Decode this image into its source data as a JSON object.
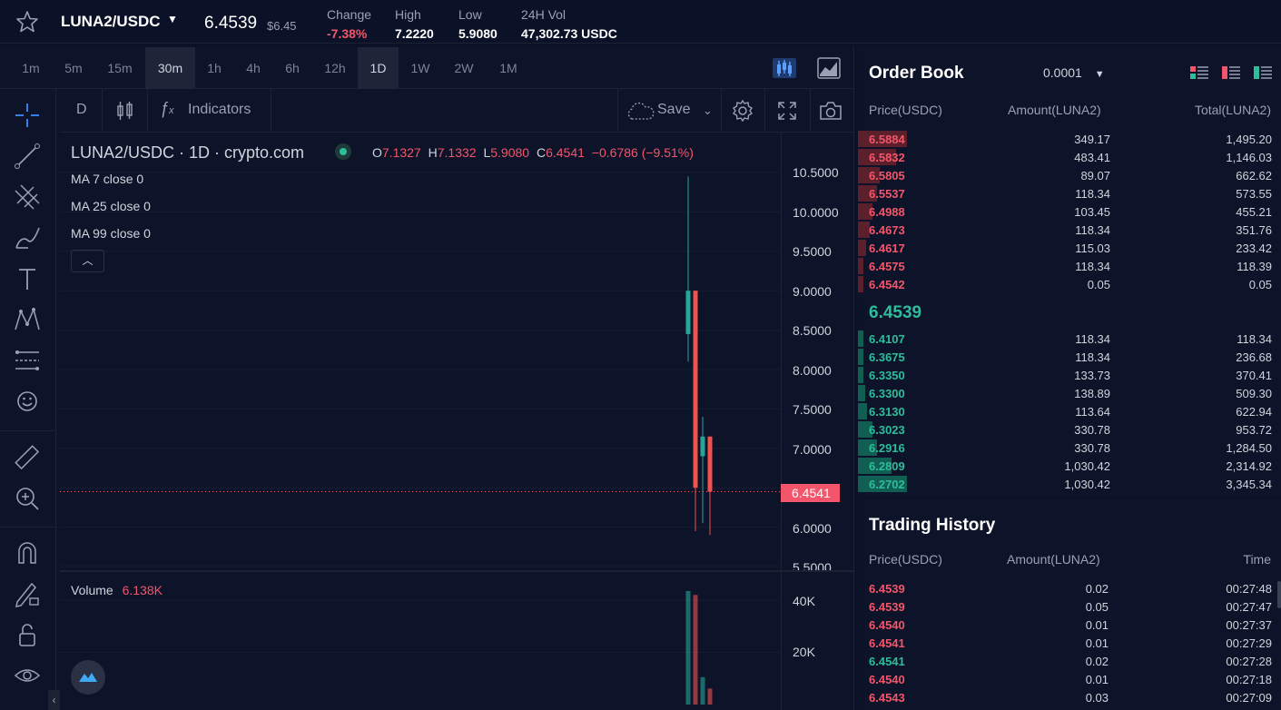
{
  "header": {
    "pair": "LUNA2/USDC",
    "last_price": "6.4539",
    "last_price_usd": "$6.45",
    "stats": [
      {
        "label": "Change",
        "value": "-7.38%",
        "negative": true
      },
      {
        "label": "High",
        "value": "7.2220",
        "negative": false
      },
      {
        "label": "Low",
        "value": "5.9080",
        "negative": false
      },
      {
        "label": "24H Vol",
        "value": "47,302.73 USDC",
        "negative": false
      }
    ]
  },
  "intervals": [
    "1m",
    "5m",
    "15m",
    "30m",
    "1h",
    "4h",
    "6h",
    "12h",
    "1D",
    "1W",
    "2W",
    "1M"
  ],
  "toolbar": {
    "resolution": "D",
    "indicators_label": "Indicators",
    "save_label": "Save"
  },
  "chart_legend": {
    "title": "LUNA2/USDC · 1D · crypto.com",
    "o_label": "O",
    "o_value": "7.1327",
    "h_label": "H",
    "h_value": "7.1332",
    "l_label": "L",
    "l_value": "5.9080",
    "c_label": "C",
    "c_value": "6.4541",
    "change": "−0.6786 (−9.51%)",
    "ma": [
      "MA 7 close 0",
      "MA 25 close 0",
      "MA 99 close 0"
    ],
    "volume_label": "Volume",
    "volume_value": "6.138K"
  },
  "chart_data": {
    "type": "candlestick",
    "price_axis_ticks": [
      "10.5000",
      "10.0000",
      "9.5000",
      "9.0000",
      "8.5000",
      "8.0000",
      "7.5000",
      "7.0000",
      "6.0000",
      "5.5000"
    ],
    "current_price_tag": "6.4541",
    "volume_axis_ticks": [
      "40K",
      "20K"
    ],
    "candles": [
      {
        "open": 8.45,
        "high": 10.45,
        "low": 8.1,
        "close": 9.0,
        "volume": 43500
      },
      {
        "open": 9.0,
        "high": 9.0,
        "low": 5.95,
        "close": 6.5,
        "volume": 42000
      },
      {
        "open": 6.9,
        "high": 7.4,
        "low": 6.05,
        "close": 7.15,
        "volume": 10500
      },
      {
        "open": 7.15,
        "high": 7.15,
        "low": 5.9,
        "close": 6.45,
        "volume": 6138
      }
    ],
    "candle_colors": [
      "up",
      "down",
      "up",
      "down"
    ],
    "colors": {
      "up": "#26a69a",
      "down": "#ef5350"
    }
  },
  "order_book": {
    "title": "Order Book",
    "precision": "0.0001",
    "headers": {
      "price": "Price(USDC)",
      "amount": "Amount(LUNA2)",
      "total": "Total(LUNA2)"
    },
    "asks": [
      {
        "price": "6.5884",
        "amount": "349.17",
        "total": "1,495.20",
        "depth": 1.0
      },
      {
        "price": "6.5832",
        "amount": "483.41",
        "total": "1,146.03",
        "depth": 0.77
      },
      {
        "price": "6.5805",
        "amount": "89.07",
        "total": "662.62",
        "depth": 0.44
      },
      {
        "price": "6.5537",
        "amount": "118.34",
        "total": "573.55",
        "depth": 0.38
      },
      {
        "price": "6.4988",
        "amount": "103.45",
        "total": "455.21",
        "depth": 0.3
      },
      {
        "price": "6.4673",
        "amount": "118.34",
        "total": "351.76",
        "depth": 0.24
      },
      {
        "price": "6.4617",
        "amount": "115.03",
        "total": "233.42",
        "depth": 0.16
      },
      {
        "price": "6.4575",
        "amount": "118.34",
        "total": "118.39",
        "depth": 0.08
      },
      {
        "price": "6.4542",
        "amount": "0.05",
        "total": "0.05",
        "depth": 0.01
      }
    ],
    "mid_price": "6.4539",
    "bids": [
      {
        "price": "6.4107",
        "amount": "118.34",
        "total": "118.34",
        "depth": 0.04
      },
      {
        "price": "6.3675",
        "amount": "118.34",
        "total": "236.68",
        "depth": 0.07
      },
      {
        "price": "6.3350",
        "amount": "133.73",
        "total": "370.41",
        "depth": 0.11
      },
      {
        "price": "6.3300",
        "amount": "138.89",
        "total": "509.30",
        "depth": 0.15
      },
      {
        "price": "6.3130",
        "amount": "113.64",
        "total": "622.94",
        "depth": 0.19
      },
      {
        "price": "6.3023",
        "amount": "330.78",
        "total": "953.72",
        "depth": 0.29
      },
      {
        "price": "6.2916",
        "amount": "330.78",
        "total": "1,284.50",
        "depth": 0.38
      },
      {
        "price": "6.2809",
        "amount": "1,030.42",
        "total": "2,314.92",
        "depth": 0.69
      },
      {
        "price": "6.2702",
        "amount": "1,030.42",
        "total": "3,345.34",
        "depth": 1.0
      }
    ]
  },
  "trading_history": {
    "title": "Trading History",
    "headers": {
      "price": "Price(USDC)",
      "amount": "Amount(LUNA2)",
      "time": "Time"
    },
    "rows": [
      {
        "price": "6.4539",
        "amount": "0.02",
        "time": "00:27:48",
        "side": "down"
      },
      {
        "price": "6.4539",
        "amount": "0.05",
        "time": "00:27:47",
        "side": "down"
      },
      {
        "price": "6.4540",
        "amount": "0.01",
        "time": "00:27:37",
        "side": "down"
      },
      {
        "price": "6.4541",
        "amount": "0.01",
        "time": "00:27:29",
        "side": "down"
      },
      {
        "price": "6.4541",
        "amount": "0.02",
        "time": "00:27:28",
        "side": "up"
      },
      {
        "price": "6.4540",
        "amount": "0.01",
        "time": "00:27:18",
        "side": "down"
      },
      {
        "price": "6.4543",
        "amount": "0.03",
        "time": "00:27:09",
        "side": "down"
      }
    ]
  }
}
